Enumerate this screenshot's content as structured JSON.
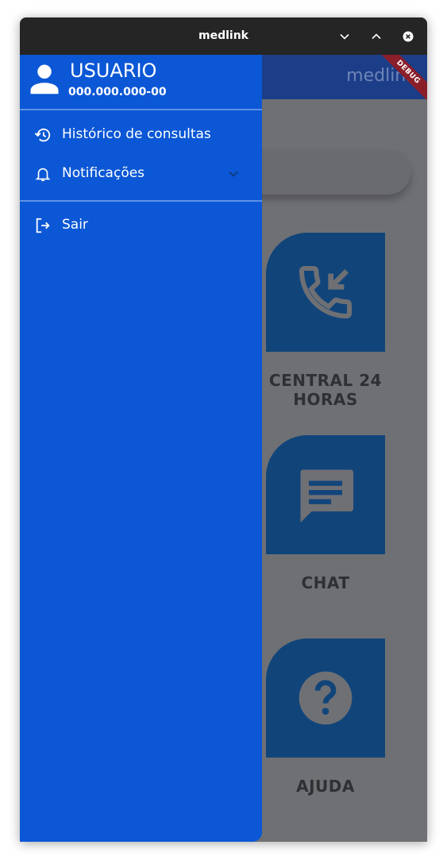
{
  "window": {
    "title": "medlink",
    "controls": [
      "chevron-down-icon",
      "chevron-up-icon",
      "close-icon"
    ]
  },
  "app": {
    "brand": "medlink",
    "debug_banner": "DEBUG",
    "tiles": [
      {
        "label": "CENTRAL 24 HORAS",
        "icon": "phone-callback-icon"
      },
      {
        "label": "CHAT",
        "icon": "chat-icon"
      },
      {
        "label": "AJUDA",
        "icon": "help-icon"
      }
    ]
  },
  "drawer": {
    "user": {
      "name": "USUARIO",
      "cpf": "000.000.000-00",
      "icon": "person-icon"
    },
    "items": [
      {
        "label": "Histórico de consultas",
        "icon": "history-icon"
      },
      {
        "label": "Notificações",
        "icon": "bell-icon"
      },
      {
        "label": "Sair",
        "icon": "logout-icon"
      }
    ]
  },
  "colors": {
    "drawer": "#0b57d6",
    "appbar": "#1c3d87",
    "tile": "#11457a",
    "scrim": "#6f7074",
    "titlebar": "#252525"
  }
}
